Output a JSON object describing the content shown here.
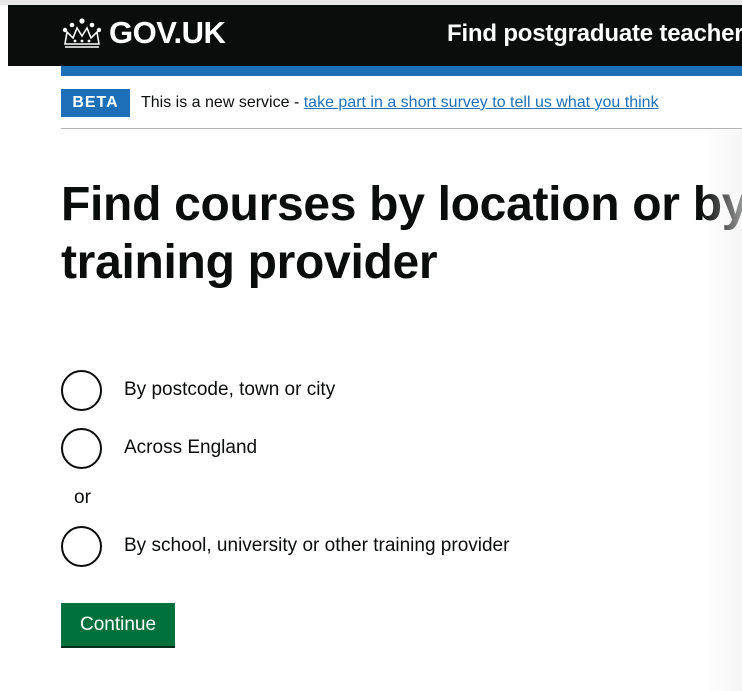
{
  "header": {
    "logo_text": "GOV.UK",
    "logo_icon": "crown-icon",
    "service_name": "Find postgraduate teacher training"
  },
  "phase_banner": {
    "tag": "BETA",
    "text": "This is a new service - ",
    "link_text": "take part in a short survey to tell us what you think"
  },
  "main": {
    "heading": "Find courses by location or by training provider",
    "radios": [
      {
        "label": "By postcode, town or city",
        "checked": false
      },
      {
        "label": "Across England",
        "checked": false
      },
      {
        "label": "By school, university or other training provider",
        "checked": false
      }
    ],
    "divider": "or",
    "continue_label": "Continue"
  },
  "colors": {
    "header_bg": "#0b0c0c",
    "brand_blue": "#1d70b8",
    "button_green": "#00703c",
    "text": "#0b0c0c"
  }
}
